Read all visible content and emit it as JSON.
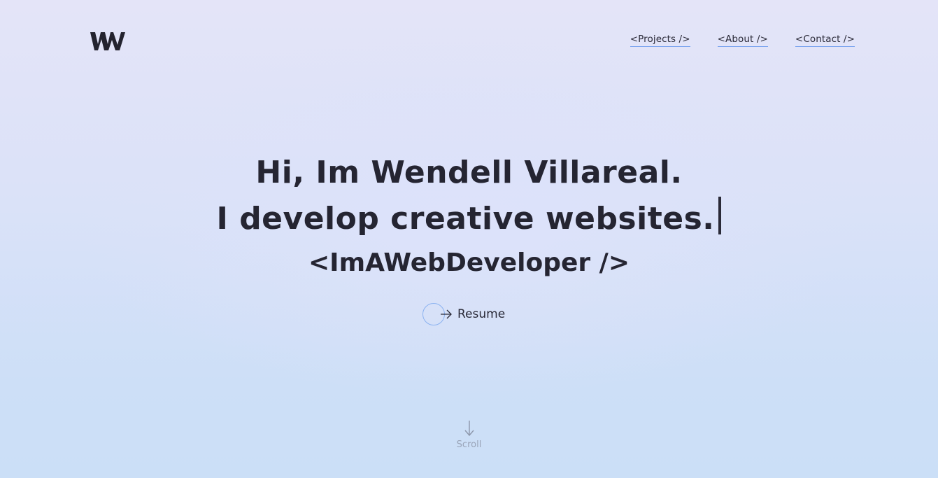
{
  "logo": {
    "text": "WV"
  },
  "nav": {
    "items": [
      {
        "label": "<Projects />"
      },
      {
        "label": "<About />"
      },
      {
        "label": "<Contact />"
      }
    ]
  },
  "hero": {
    "line1": "Hi, Im Wendell Villareal.",
    "line2": "I develop creative websites.",
    "line3": "<ImAWebDeveloper />"
  },
  "resume": {
    "label": "Resume"
  },
  "scroll": {
    "label": "Scroll"
  },
  "colors": {
    "text": "#252532",
    "accent": "#7aa3ee",
    "muted": "#9aa4b8"
  }
}
